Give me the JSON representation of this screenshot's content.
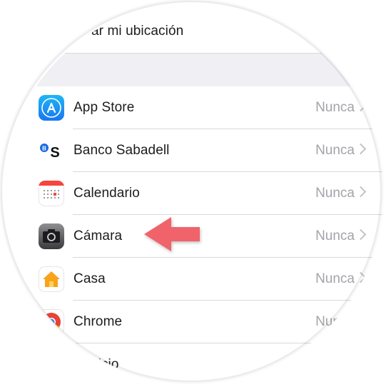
{
  "top_item": {
    "label": "ar mi ubicación"
  },
  "apps": [
    {
      "label": "App Store",
      "value": "Nunca",
      "icon": "app-store-icon"
    },
    {
      "label": "Banco Sabadell",
      "value": "Nunca",
      "icon": "banco-sabadell-icon"
    },
    {
      "label": "Calendario",
      "value": "Nunca",
      "icon": "calendar-icon"
    },
    {
      "label": "Cámara",
      "value": "Nunca",
      "icon": "camera-icon"
    },
    {
      "label": "Casa",
      "value": "Nunca",
      "icon": "home-icon"
    },
    {
      "label": "Chrome",
      "value": "Nunca",
      "icon": "chrome-icon"
    },
    {
      "label": "cicio",
      "value": "",
      "icon": "fitness-icon"
    }
  ],
  "colors": {
    "accent_arrow": "#f0646a",
    "value_text": "#a4a4a9",
    "group_gap": "#efeff4"
  }
}
